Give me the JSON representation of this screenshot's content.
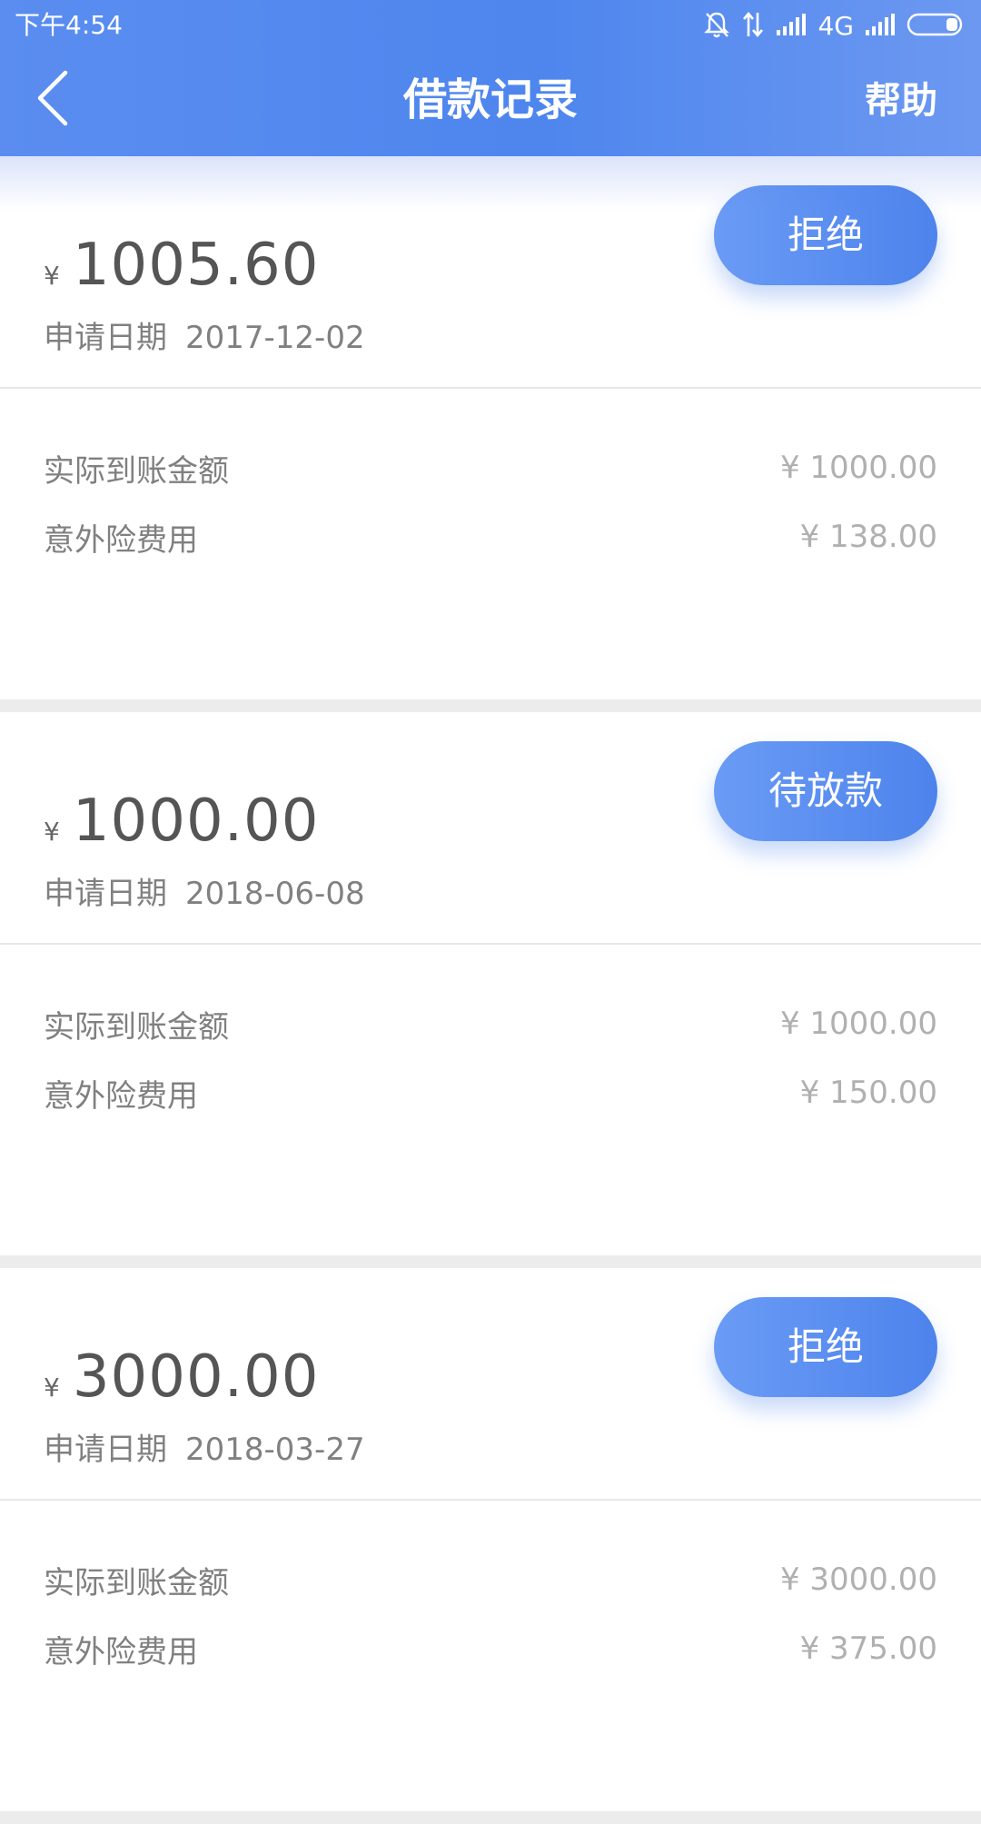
{
  "status_bar": {
    "time": "下午4:54",
    "network": "4G",
    "icons": [
      "bell-off-icon",
      "data-arrows-icon",
      "signal-icon",
      "signal-icon",
      "battery-icon"
    ]
  },
  "header": {
    "title": "借款记录",
    "help_label": "帮助",
    "back_icon": "chevron-left-icon"
  },
  "colors": {
    "header_gradient_start": "#5B8DF0",
    "header_gradient_end": "#6C98F1",
    "pill_gradient_start": "#6A9BF5",
    "pill_gradient_end": "#4D83EC"
  },
  "labels": {
    "currency": "¥",
    "apply_date": "申请日期",
    "actual_amount": "实际到账金额",
    "insurance_fee": "意外险费用"
  },
  "records": [
    {
      "amount": "1005.60",
      "status": "拒绝",
      "apply_date": "2017-12-02",
      "actual_amount": "¥ 1000.00",
      "insurance_fee": "¥ 138.00"
    },
    {
      "amount": "1000.00",
      "status": "待放款",
      "apply_date": "2018-06-08",
      "actual_amount": "¥ 1000.00",
      "insurance_fee": "¥ 150.00"
    },
    {
      "amount": "3000.00",
      "status": "拒绝",
      "apply_date": "2018-03-27",
      "actual_amount": "¥ 3000.00",
      "insurance_fee": "¥ 375.00"
    }
  ]
}
